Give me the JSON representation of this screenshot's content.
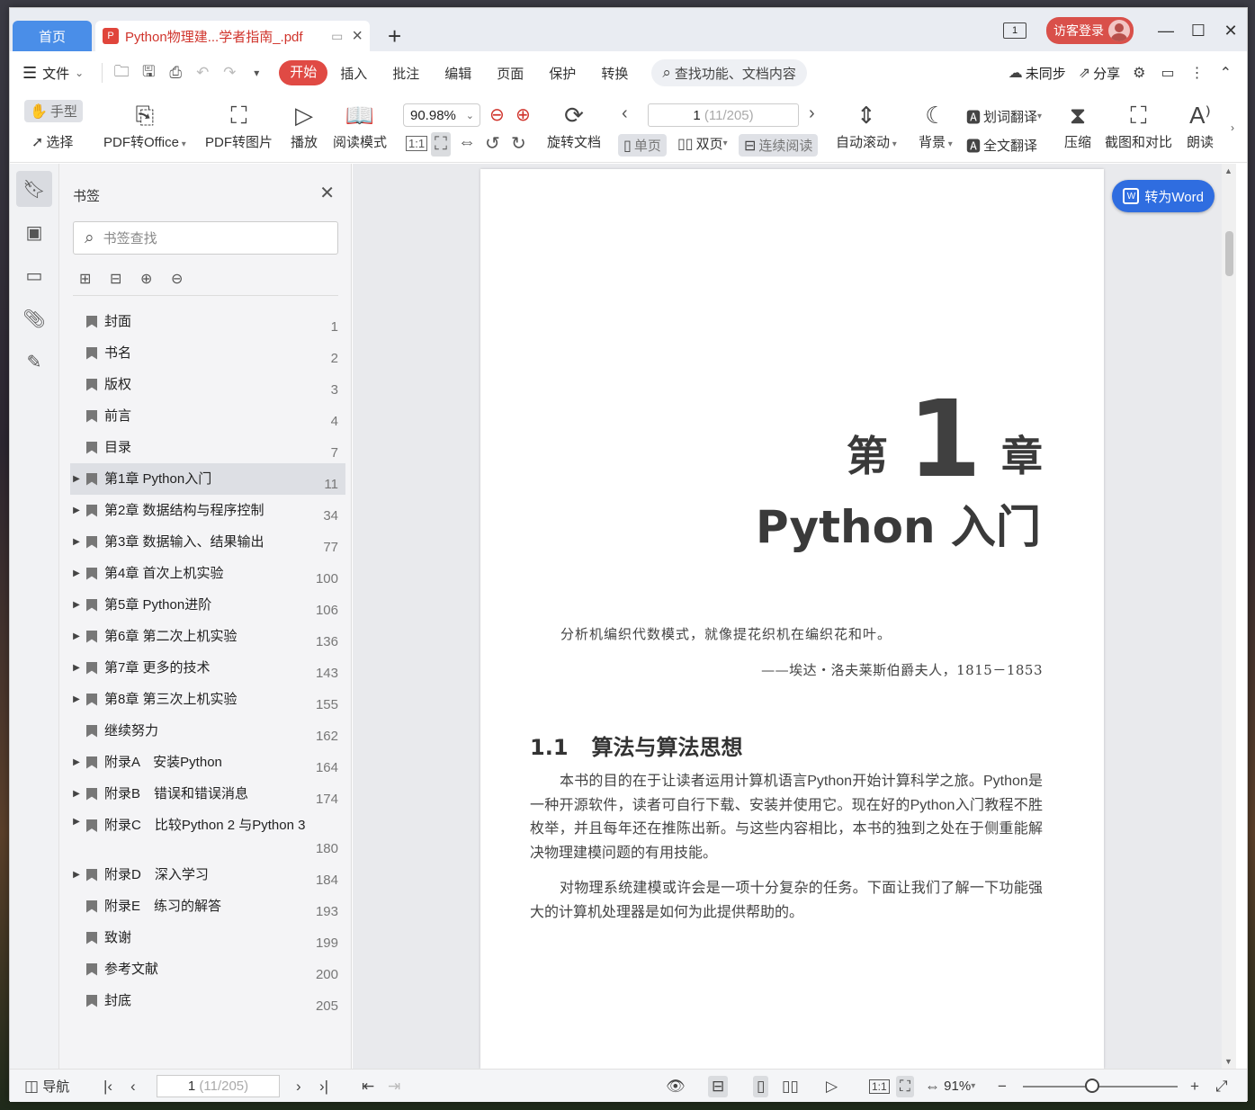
{
  "tabs": {
    "home": "首页",
    "doc_title": "Python物理建...学者指南_.pdf",
    "pdf_icon": "P",
    "new_tab": "+"
  },
  "titlebar": {
    "page_indicator": "1",
    "login_label": "访客登录",
    "minimize": "—",
    "maximize": "☐",
    "close": "✕"
  },
  "menu": {
    "file": "文件",
    "tabs": [
      "开始",
      "插入",
      "批注",
      "编辑",
      "页面",
      "保护",
      "转换"
    ],
    "search": "查找功能、文档内容",
    "sync": "未同步",
    "share": "分享"
  },
  "ribbon": {
    "hand": "手型",
    "select": "选择",
    "pdf_to_office": "PDF转Office",
    "pdf_to_image": "PDF转图片",
    "play": "播放",
    "read_mode": "阅读模式",
    "zoom_value": "90.98%",
    "rotate_doc": "旋转文档",
    "page_current": "1",
    "page_total": "(11/205)",
    "single_page": "单页",
    "double_page": "双页",
    "continuous": "连续阅读",
    "auto_scroll": "自动滚动",
    "background": "背景",
    "word_translate": "划词翻译",
    "full_translate": "全文翻译",
    "compress": "压缩",
    "screenshot_compare": "截图和对比",
    "read_aloud": "朗读",
    "actual_size": "1:1"
  },
  "bookmarks": {
    "title": "书签",
    "search_placeholder": "书签查找",
    "items": [
      {
        "label": "封面",
        "page": "1",
        "expandable": false
      },
      {
        "label": "书名",
        "page": "2",
        "expandable": false
      },
      {
        "label": "版权",
        "page": "3",
        "expandable": false
      },
      {
        "label": "前言",
        "page": "4",
        "expandable": false
      },
      {
        "label": "目录",
        "page": "7",
        "expandable": false
      },
      {
        "label": "第1章 Python入门",
        "page": "11",
        "expandable": true,
        "selected": true
      },
      {
        "label": "第2章 数据结构与程序控制",
        "page": "34",
        "expandable": true
      },
      {
        "label": "第3章 数据输入、结果输出",
        "page": "77",
        "expandable": true
      },
      {
        "label": "第4章 首次上机实验",
        "page": "100",
        "expandable": true
      },
      {
        "label": "第5章 Python进阶",
        "page": "106",
        "expandable": true
      },
      {
        "label": "第6章 第二次上机实验",
        "page": "136",
        "expandable": true
      },
      {
        "label": "第7章 更多的技术",
        "page": "143",
        "expandable": true
      },
      {
        "label": "第8章 第三次上机实验",
        "page": "155",
        "expandable": true
      },
      {
        "label": "继续努力",
        "page": "162",
        "expandable": false
      },
      {
        "label": "附录A　安装Python",
        "page": "164",
        "expandable": true
      },
      {
        "label": "附录B　错误和错误消息",
        "page": "174",
        "expandable": true
      },
      {
        "label": "附录C　比较Python 2 与Python 3",
        "page": "180",
        "expandable": true,
        "tall": true
      },
      {
        "label": "附录D　深入学习",
        "page": "184",
        "expandable": true
      },
      {
        "label": "附录E　练习的解答",
        "page": "193",
        "expandable": false
      },
      {
        "label": "致谢",
        "page": "199",
        "expandable": false
      },
      {
        "label": "参考文献",
        "page": "200",
        "expandable": false
      },
      {
        "label": "封底",
        "page": "205",
        "expandable": false
      }
    ]
  },
  "document": {
    "chapter_prefix": "第",
    "chapter_number": "1",
    "chapter_suffix": "章",
    "chapter_title": "Python 入门",
    "epigraph": "分析机编织代数模式，就像提花织机在编织花和叶。",
    "attribution": "——埃达・洛夫莱斯伯爵夫人，1815－1853",
    "section_number": "1.1",
    "section_title": "算法与算法思想",
    "paragraph1": "本书的目的在于让读者运用计算机语言Python开始计算科学之旅。Python是一种开源软件，读者可自行下载、安装并使用它。现在好的Python入门教程不胜枚举，并且每年还在推陈出新。与这些内容相比，本书的独到之处在于侧重能解决物理建模问题的有用技能。",
    "paragraph2": "对物理系统建模或许会是一项十分复杂的任务。下面让我们了解一下功能强大的计算机处理器是如何为此提供帮助的。",
    "to_word": "转为Word"
  },
  "statusbar": {
    "nav": "导航",
    "page_current": "1",
    "page_total": "(11/205)",
    "zoom": "91%",
    "actual_size": "1:1"
  }
}
